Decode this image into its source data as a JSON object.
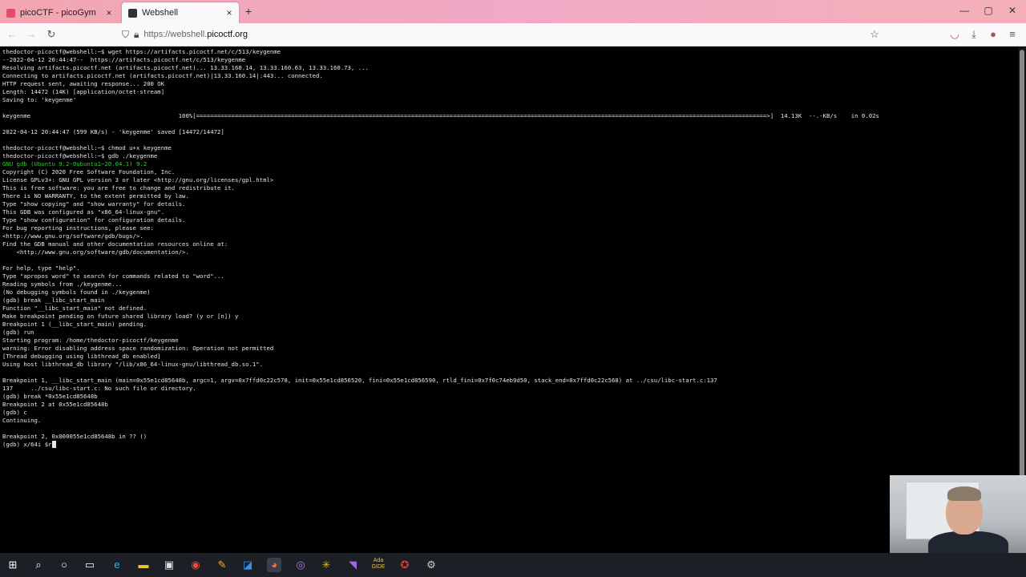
{
  "browser": {
    "tabs": [
      {
        "title": "picoCTF - picoGym",
        "close": "×"
      },
      {
        "title": "Webshell",
        "close": "×"
      }
    ],
    "new_tab": "+",
    "window_controls": {
      "minimize": "—",
      "maximize": "▢",
      "close": "✕"
    },
    "url_prefix": "https://webshell.",
    "url_host": "picoctf.org",
    "icons": [
      "back-icon",
      "forward-icon",
      "reload-icon",
      "shield-icon",
      "lock-icon",
      "star-icon",
      "pocket-icon",
      "download-icon",
      "extension-icon",
      "menu-icon"
    ]
  },
  "terminal": {
    "lines": [
      "thedoctor-picoctf@webshell:~$ wget https://artifacts.picoctf.net/c/513/keygenme",
      "--2022-04-12 20:44:47--  https://artifacts.picoctf.net/c/513/keygenme",
      "Resolving artifacts.picoctf.net (artifacts.picoctf.net)... 13.33.160.14, 13.33.160.63, 13.33.160.73, ...",
      "Connecting to artifacts.picoctf.net (artifacts.picoctf.net)|13.33.160.14|:443... connected.",
      "HTTP request sent, awaiting response... 200 OK",
      "Length: 14472 (14K) [application/octet-stream]",
      "Saving to: 'keygenme'",
      "",
      "keygenme                                          100%[==================================================================================================================================================================>]  14.13K  --.-KB/s    in 0.02s",
      "",
      "2022-04-12 20:44:47 (599 KB/s) - 'keygenme' saved [14472/14472]",
      "",
      "thedoctor-picoctf@webshell:~$ chmod u+x keygenme",
      "thedoctor-picoctf@webshell:~$ gdb ./keygenme",
      "GNU gdb (Ubuntu 9.2-0ubuntu1~20.04.1) 9.2",
      "Copyright (C) 2020 Free Software Foundation, Inc.",
      "License GPLv3+: GNU GPL version 3 or later <http://gnu.org/licenses/gpl.html>",
      "This is free software: you are free to change and redistribute it.",
      "There is NO WARRANTY, to the extent permitted by law.",
      "Type \"show copying\" and \"show warranty\" for details.",
      "This GDB was configured as \"x86_64-linux-gnu\".",
      "Type \"show configuration\" for configuration details.",
      "For bug reporting instructions, please see:",
      "<http://www.gnu.org/software/gdb/bugs/>.",
      "Find the GDB manual and other documentation resources online at:",
      "    <http://www.gnu.org/software/gdb/documentation/>.",
      "",
      "For help, type \"help\".",
      "Type \"apropos word\" to search for commands related to \"word\"...",
      "Reading symbols from ./keygenme...",
      "(No debugging symbols found in ./keygenme)",
      "(gdb) break __libc_start_main",
      "Function \"__libc_start_main\" not defined.",
      "Make breakpoint pending on future shared library load? (y or [n]) y",
      "Breakpoint 1 (__libc_start_main) pending.",
      "(gdb) run",
      "Starting program: /home/thedoctor-picoctf/keygenme",
      "warning: Error disabling address space randomization: Operation not permitted",
      "[Thread debugging using libthread_db enabled]",
      "Using host libthread_db library \"/lib/x86_64-linux-gnu/libthread_db.so.1\".",
      "",
      "Breakpoint 1, __libc_start_main (main=0x55e1cd85648b, argc=1, argv=0x7ffd0c22c578, init=0x55e1cd856520, fini=0x55e1cd856590, rtld_fini=0x7f0c74eb9d50, stack_end=0x7ffd0c22c568) at ../csu/libc-start.c:137",
      "137     ../csu/libc-start.c: No such file or directory.",
      "(gdb) break *0x55e1cd85648b",
      "Breakpoint 2 at 0x55e1cd85648b",
      "(gdb) c",
      "Continuing.",
      "",
      "Breakpoint 2, 0x000055e1cd85648b in ?? ()",
      "(gdb) x/64i $r"
    ]
  },
  "taskbar": {
    "items": [
      "windows-start-icon",
      "search-icon",
      "cortana-icon",
      "task-view-icon",
      "edge-icon",
      "file-explorer-icon",
      "store-icon",
      "chrome-icon",
      "app-icon-a",
      "app-icon-b",
      "firefox-icon",
      "app-icon-c",
      "slack-icon",
      "visual-studio-icon",
      "ada-gide-icon",
      "app-icon-d",
      "app-icon-e"
    ],
    "ada_label": "Ada\nGIDE"
  }
}
